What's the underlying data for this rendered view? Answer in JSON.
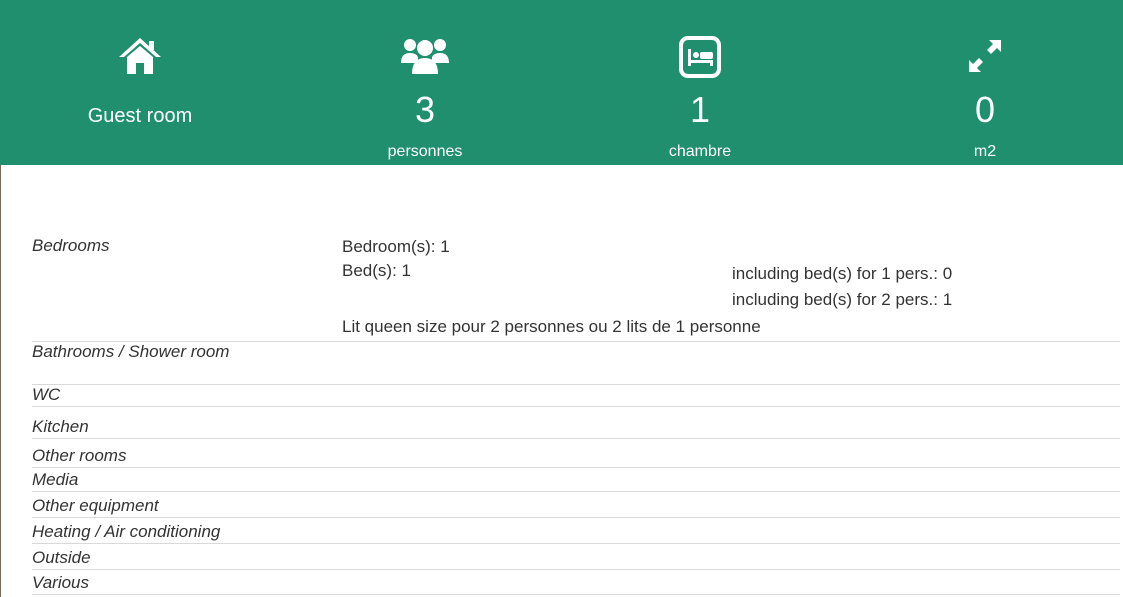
{
  "header": {
    "type_label": "Guest room",
    "persons": {
      "value": "3",
      "unit": "personnes"
    },
    "rooms": {
      "value": "1",
      "unit": "chambre"
    },
    "area": {
      "value": "0",
      "unit": "m2"
    },
    "icons": {
      "type": "home-icon",
      "persons": "users-icon",
      "rooms": "bed-icon",
      "area": "expand-icon"
    },
    "colors": {
      "background": "#1f8f6e",
      "text": "#ffffff"
    }
  },
  "bedrooms": {
    "label": "Bedrooms",
    "count_line": "Bedroom(s): 1",
    "beds_line": "Bed(s):  1",
    "single_beds": "including bed(s) for 1 pers.: 0",
    "double_beds": "including bed(s) for 2 pers.: 1",
    "note": "Lit queen size pour 2 personnes ou 2 lits de 1 personne"
  },
  "rows": [
    "Bathrooms / Shower room",
    "WC",
    "Kitchen",
    "Other rooms",
    "Media",
    "Other equipment",
    "Heating / Air conditioning",
    "Outside",
    "Various"
  ]
}
